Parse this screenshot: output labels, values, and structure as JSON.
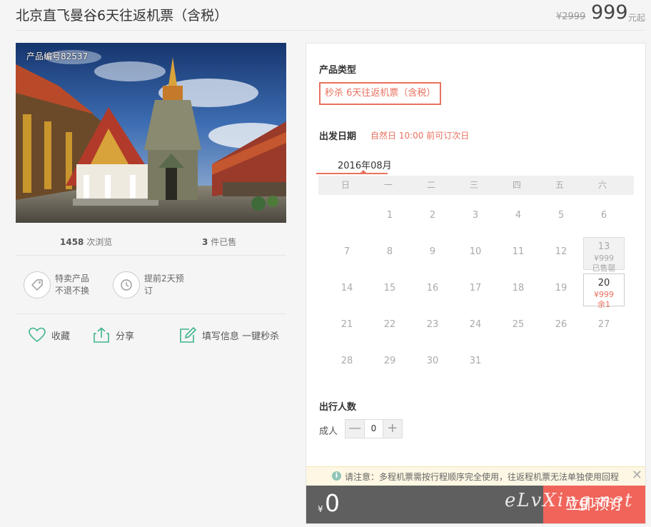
{
  "header": {
    "title": "北京直飞曼谷6天往返机票（含税）",
    "original_price": "¥2999",
    "price": "999",
    "price_unit": "元起"
  },
  "photo": {
    "product_code": "产品编号82537"
  },
  "stats": {
    "views_count": "1458",
    "views_label": "次浏览",
    "sold_count": "3",
    "sold_label": "件已售"
  },
  "features": [
    {
      "icon": "tag-icon",
      "line1": "特卖产品",
      "line2": "不退不换"
    },
    {
      "icon": "clock-icon",
      "line1": "提前2天预",
      "line2": "订"
    }
  ],
  "actions": {
    "favorite": "收藏",
    "share": "分享",
    "fill_info": "填写信息 一键秒杀"
  },
  "booking": {
    "product_type_title": "产品类型",
    "product_type_option": "秒杀 6天往返机票（含税）",
    "departure_title": "出发日期",
    "departure_note": "自然日 10:00 前可订次日",
    "month": "2016年08月",
    "weekdays": [
      "日",
      "一",
      "二",
      "三",
      "四",
      "五",
      "六"
    ],
    "weeks": [
      [
        {
          "d": ""
        },
        {
          "d": "1"
        },
        {
          "d": "2"
        },
        {
          "d": "3"
        },
        {
          "d": "4"
        },
        {
          "d": "5"
        },
        {
          "d": "6"
        }
      ],
      [
        {
          "d": "7"
        },
        {
          "d": "8"
        },
        {
          "d": "9"
        },
        {
          "d": "10"
        },
        {
          "d": "11"
        },
        {
          "d": "12"
        },
        {
          "d": "13",
          "price": "¥999",
          "status": "已售罄",
          "state": "soldout"
        }
      ],
      [
        {
          "d": "14"
        },
        {
          "d": "15"
        },
        {
          "d": "16"
        },
        {
          "d": "17"
        },
        {
          "d": "18"
        },
        {
          "d": "19"
        },
        {
          "d": "20",
          "price": "¥999",
          "status": "余1",
          "state": "avail"
        }
      ],
      [
        {
          "d": "21"
        },
        {
          "d": "22"
        },
        {
          "d": "23"
        },
        {
          "d": "24"
        },
        {
          "d": "25"
        },
        {
          "d": "26"
        },
        {
          "d": "27"
        }
      ],
      [
        {
          "d": "28"
        },
        {
          "d": "29"
        },
        {
          "d": "30"
        },
        {
          "d": "31"
        },
        {
          "d": ""
        },
        {
          "d": ""
        },
        {
          "d": ""
        }
      ]
    ],
    "travelers_title": "出行人数",
    "adult_label": "成人",
    "adult_count": "0",
    "minus": "—",
    "plus": "+"
  },
  "notice": {
    "icon": "i",
    "text": "请注意：多程机票需按行程顺序完全使用，往返程机票无法单独使用回程",
    "close": "✕"
  },
  "footer": {
    "currency": "¥",
    "total": "0",
    "book_label": "立即预订",
    "watermark": "eLvXing.net"
  },
  "colors": {
    "accent": "#e8715f",
    "book_button": "#f0645a",
    "bar": "#5f5f5f",
    "feature_green": "#3fb48f"
  }
}
